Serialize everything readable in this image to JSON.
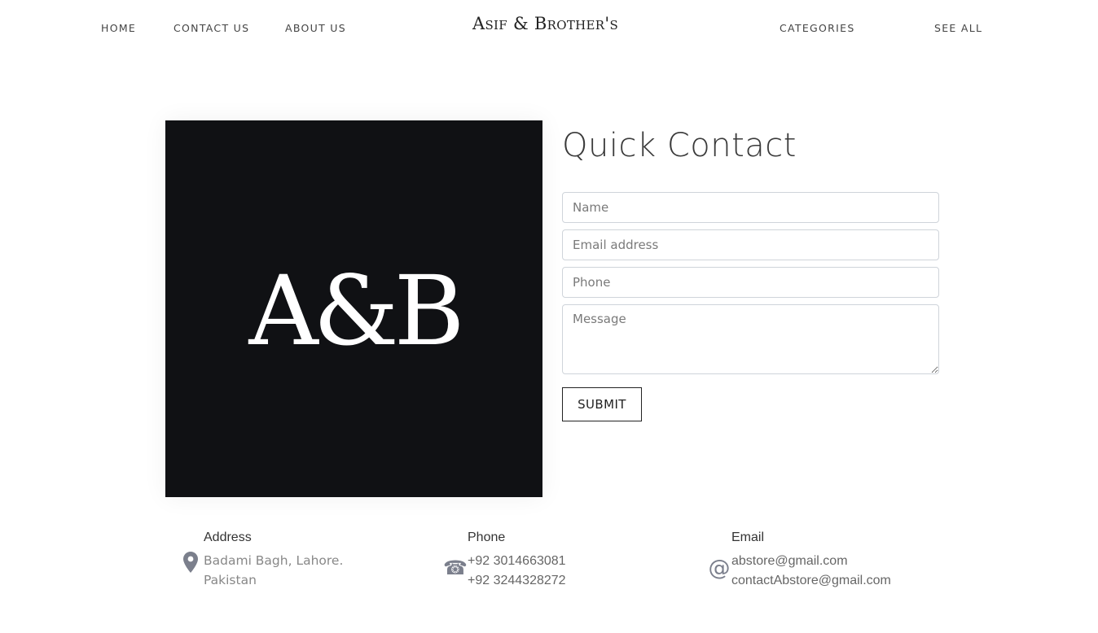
{
  "nav": {
    "home": "HOME",
    "contact": "CONTACT US",
    "about": "ABOUT US",
    "brand": "Asif & Brother's",
    "categories": "CATEGORIES",
    "see_all": "SEE ALL"
  },
  "logo": {
    "text": "A&B"
  },
  "contact_form": {
    "title": "Quick Contact",
    "name_placeholder": "Name",
    "email_placeholder": "Email address",
    "phone_placeholder": "Phone",
    "message_placeholder": "Message",
    "submit_label": "SUBMIT"
  },
  "info": {
    "address": {
      "heading": "Address",
      "line1": "Badami Bagh, Lahore.",
      "line2": "Pakistan",
      "icon": "map-pin-icon"
    },
    "phone": {
      "heading": "Phone",
      "line1": "+92 3014663081",
      "line2": "+92 3244328272",
      "icon": "telephone-icon"
    },
    "email": {
      "heading": "Email",
      "line1": "abstore@gmail.com",
      "line2": "contactAbstore@gmail.com",
      "icon": "at-sign-icon"
    }
  },
  "colors": {
    "logo_bg": "#101114",
    "icon": "#7b7f8c",
    "text": "#333333"
  }
}
